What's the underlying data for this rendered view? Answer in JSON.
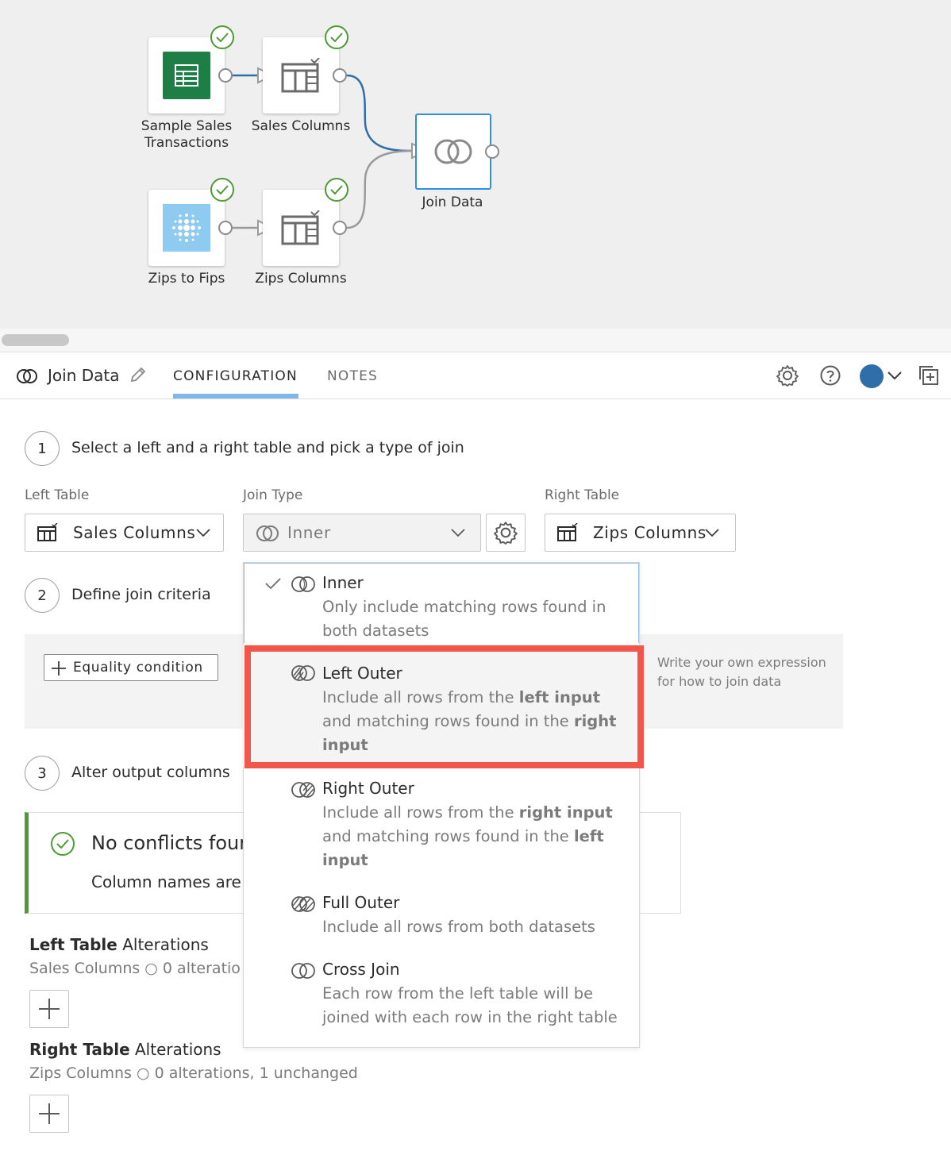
{
  "canvas": {
    "nodes": [
      {
        "label": "Sample Sales Transactions"
      },
      {
        "label": "Sales Columns"
      },
      {
        "label": "Zips to Fips"
      },
      {
        "label": "Zips Columns"
      },
      {
        "label": "Join Data"
      }
    ]
  },
  "panel": {
    "title": "Join Data",
    "tabs": [
      "CONFIGURATION",
      "NOTES"
    ],
    "active_tab": "CONFIGURATION"
  },
  "steps": [
    {
      "number": "1",
      "text": "Select a left and a right table and pick a type of join"
    },
    {
      "number": "2",
      "text": "Define join criteria"
    },
    {
      "number": "3",
      "text": "Alter output columns"
    }
  ],
  "fields": {
    "left_table": {
      "label": "Left Table",
      "value": "Sales Columns"
    },
    "join_type": {
      "label": "Join Type",
      "value": "Inner"
    },
    "right_table": {
      "label": "Right Table",
      "value": "Zips Columns"
    }
  },
  "criteria": {
    "equality_button": "Equality condition",
    "expression_hint_line1": "Write your own expression",
    "expression_hint_line2": "for how to join data"
  },
  "conflicts": {
    "title": "No conflicts four",
    "text": "Column names are"
  },
  "alterations": {
    "left_title_bold": "Left Table",
    "left_title_rest": " Alterations",
    "left_sub": "Sales Columns ○ 0 alteratio",
    "right_title_bold": "Right Table",
    "right_title_rest": " Alterations",
    "right_sub": "Zips Columns ○ 0 alterations, 1 unchanged"
  },
  "dropdown": {
    "options": [
      {
        "title": "Inner",
        "desc_line1": "Only include matching rows found in",
        "desc_line2": "both datasets",
        "selected": true
      },
      {
        "title": "Left Outer",
        "desc_a": "Include all rows from the ",
        "desc_b": "left input",
        "desc_c": " and matching rows found in the ",
        "desc_d": "right input",
        "highlighted": true
      },
      {
        "title": "Right Outer",
        "desc_a": "Include all rows from the ",
        "desc_b": "right input",
        "desc_c": " and matching rows found in the ",
        "desc_d": "left input"
      },
      {
        "title": "Full Outer",
        "desc_line1": "Include all rows from both datasets"
      },
      {
        "title": "Cross Join",
        "desc_line1": "Each row from the left table will be",
        "desc_line2": "joined with each row in the right table"
      }
    ]
  },
  "colors": {
    "accent_blue": "#2f8fe0",
    "success_green": "#4e9a36",
    "highlight_red": "#f2564b",
    "sheets_green": "#1e7e45",
    "user_avatar": "#2f6ea8"
  }
}
